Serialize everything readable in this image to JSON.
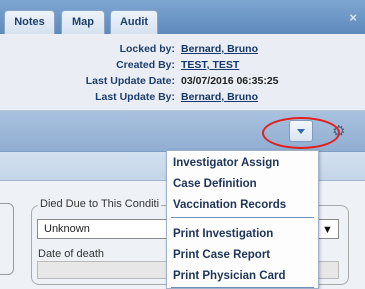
{
  "tabs": [
    {
      "label": "Notes"
    },
    {
      "label": "Map"
    },
    {
      "label": "Audit"
    }
  ],
  "window": {
    "close_glyph": "×"
  },
  "audit": {
    "locked_by_label": "Locked by:",
    "locked_by_value": "Bernard, Bruno",
    "created_by_label": "Created By:",
    "created_by_value": "TEST, TEST",
    "last_update_date_label": "Last Update Date:",
    "last_update_date_value": "03/07/2016 06:35:25",
    "last_update_by_label": "Last Update By:",
    "last_update_by_value": "Bernard, Bruno"
  },
  "toolbar": {
    "menu_icon": "chevron-down-icon",
    "settings_icon": "gear-icon",
    "highlight_color": "#e0201c"
  },
  "form": {
    "died_due_label": "Died Due to This Conditi",
    "died_due_value": "Unknown",
    "date_of_death_label": "Date of death"
  },
  "menu": {
    "group1": [
      {
        "label": "Investigator Assign"
      },
      {
        "label": "Case Definition"
      },
      {
        "label": "Vaccination Records"
      }
    ],
    "group2": [
      {
        "label": "Print Investigation"
      },
      {
        "label": "Print Case Report"
      },
      {
        "label": "Print Physician Card"
      }
    ]
  }
}
